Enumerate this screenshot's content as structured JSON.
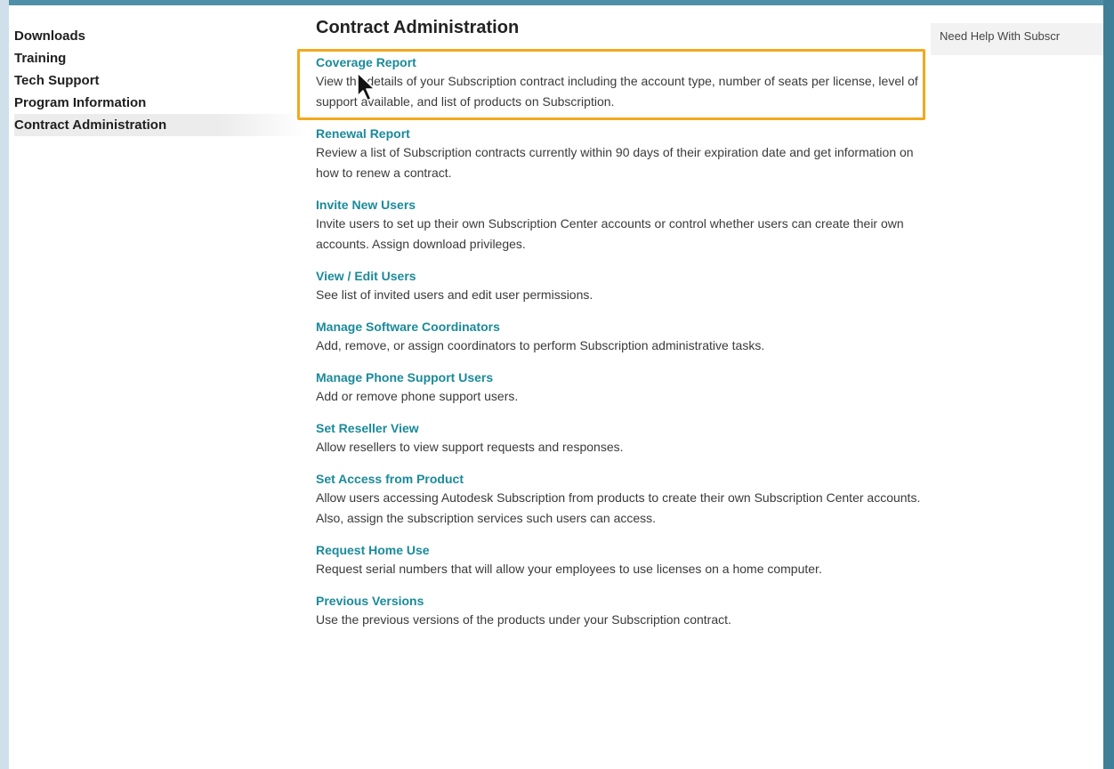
{
  "sidebar": {
    "items": [
      {
        "label": "Downloads"
      },
      {
        "label": "Training"
      },
      {
        "label": "Tech Support"
      },
      {
        "label": "Program Information"
      },
      {
        "label": "Contract Administration"
      }
    ]
  },
  "main": {
    "title": "Contract Administration",
    "sections": [
      {
        "link": "Coverage Report",
        "description": "View the details of your Subscription contract including the account type, number of seats per license, level of support available, and list of products on Subscription."
      },
      {
        "link": "Renewal Report",
        "description": "Review a list of Subscription contracts currently within 90 days of their expiration date and get information on how to renew a contract."
      },
      {
        "link": "Invite New Users",
        "description": "Invite users to set up their own Subscription Center accounts or control whether users can create their own accounts. Assign download privileges."
      },
      {
        "link": "View / Edit Users",
        "description": "See list of invited users and edit user permissions."
      },
      {
        "link": "Manage Software Coordinators",
        "description": "Add, remove, or assign coordinators to perform Subscription administrative tasks."
      },
      {
        "link": "Manage Phone Support Users",
        "description": "Add or remove phone support users."
      },
      {
        "link": "Set Reseller View",
        "description": "Allow resellers to view support requests and responses."
      },
      {
        "link": "Set Access from Product",
        "description": "Allow users accessing Autodesk Subscription from products to create their own Subscription Center accounts. Also, assign the subscription services such users can access."
      },
      {
        "link": "Request Home Use",
        "description": "Request serial numbers that will allow your employees to use licenses on a home computer."
      },
      {
        "link": "Previous Versions",
        "description": "Use the previous versions of the products under your Subscription contract."
      }
    ]
  },
  "help": {
    "label": "Need Help With Subscr"
  },
  "colors": {
    "link": "#1a8a9a",
    "highlight": "#f2a91e",
    "frame": "#4f8fa8"
  }
}
